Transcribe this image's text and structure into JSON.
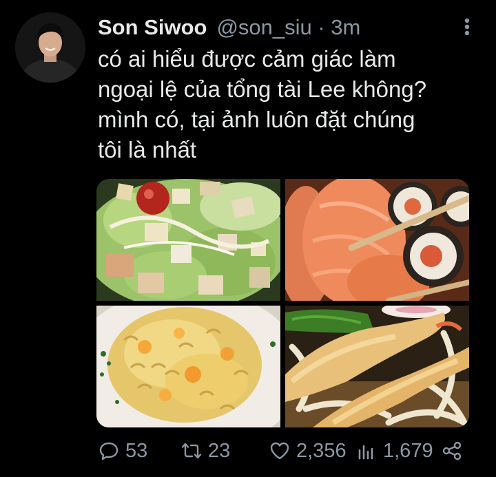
{
  "tweet": {
    "author_name": "Son Siwoo",
    "handle_time": "@son_siu · 3m",
    "text_lines": [
      "có ai hiểu được cảm giác làm",
      "ngoại lệ của tổng tài Lee không?",
      "mình có, tại ảnh luôn đặt chúng",
      "tôi là nhất"
    ]
  },
  "media": {
    "photos": [
      "caesar salad",
      "salmon sashimi and sushi rolls",
      "macaroni and cheese",
      "shrimp tempura udon"
    ]
  },
  "actions": {
    "replies": "53",
    "retweets": "23",
    "likes": "2,356",
    "views": "1,679"
  },
  "colors": {
    "background": "#000000",
    "text": "#e7e9ea",
    "muted": "#8b98a5"
  },
  "icons": [
    "more-vertical-icon",
    "reply-icon",
    "retweet-icon",
    "like-icon",
    "analytics-icon",
    "share-icon"
  ]
}
